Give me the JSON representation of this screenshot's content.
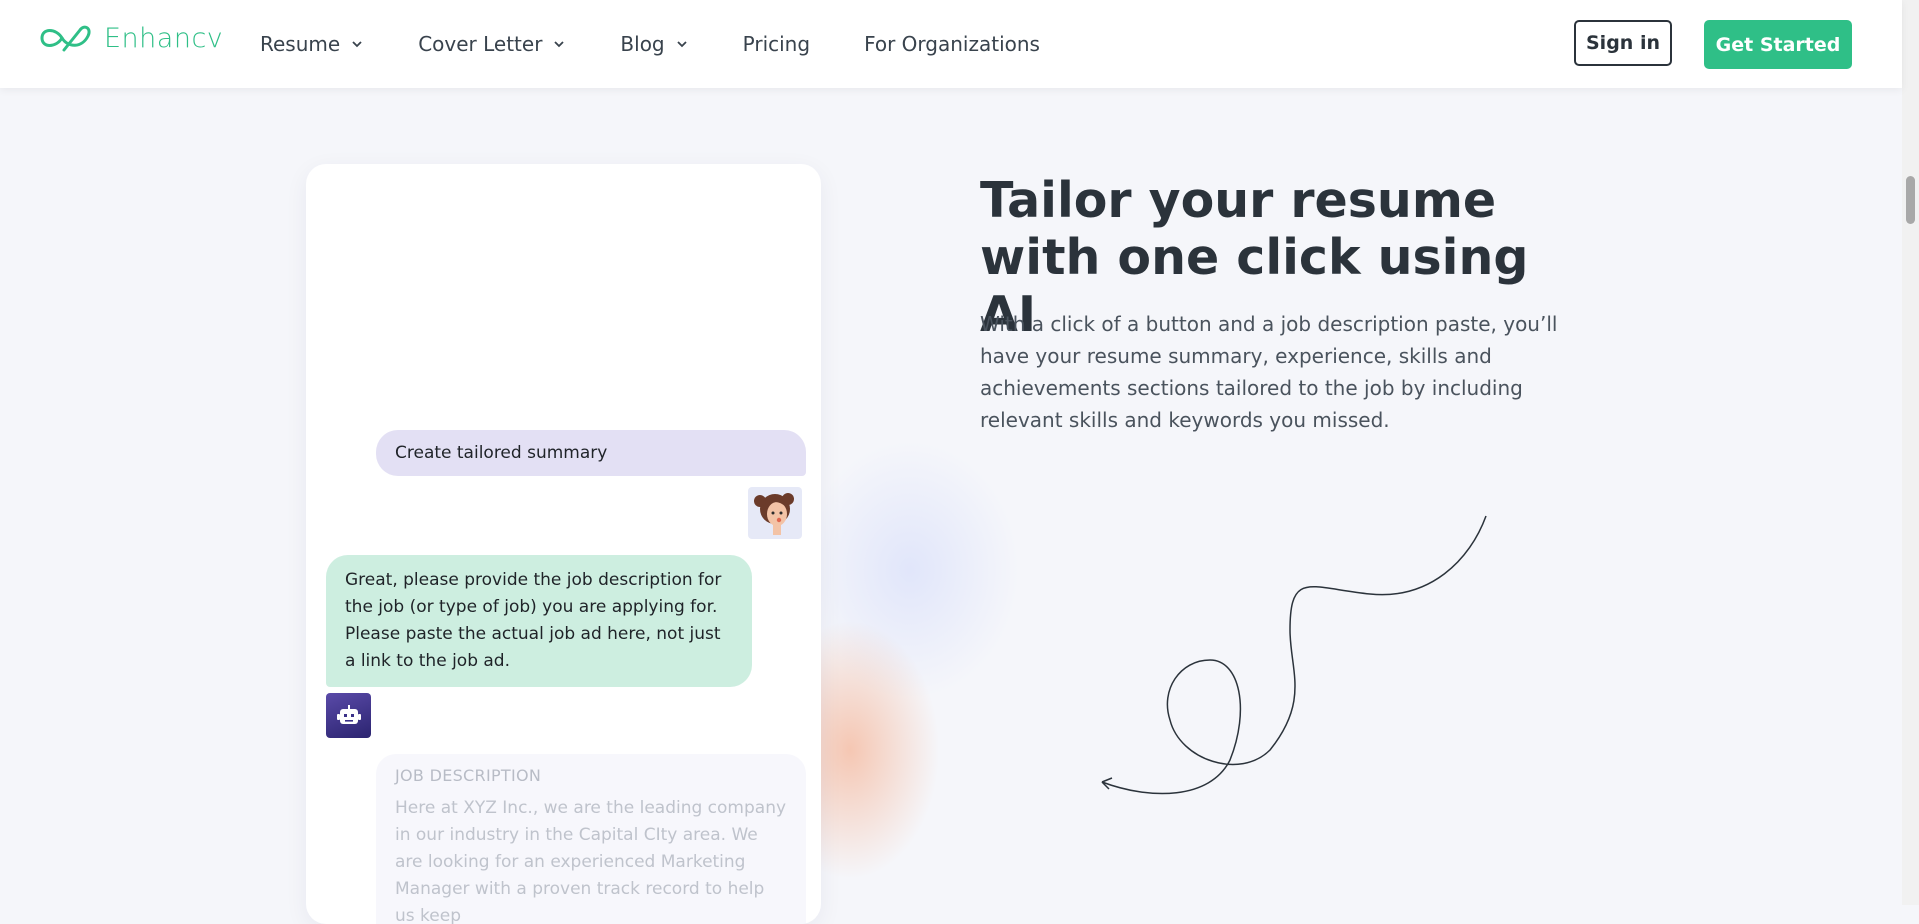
{
  "header": {
    "logo_text": "Enhancv",
    "nav": [
      {
        "label": "Resume",
        "has_dropdown": true
      },
      {
        "label": "Cover Letter",
        "has_dropdown": true
      },
      {
        "label": "Blog",
        "has_dropdown": true
      },
      {
        "label": "Pricing",
        "has_dropdown": false
      },
      {
        "label": "For Organizations",
        "has_dropdown": false
      }
    ],
    "sign_in_label": "Sign in",
    "get_started_label": "Get Started"
  },
  "chat": {
    "user_message": "Create tailored summary",
    "bot_message": "Great, please provide the job description for the job (or type of job) you are applying for. Please paste the actual job ad here, not just a link to the job ad.",
    "job_description_label": "JOB DESCRIPTION",
    "job_description_text": "Here at XYZ Inc., we are the leading company in our industry in the Capital CIty area. We are looking for an experienced Marketing Manager with a proven track record to help us keep"
  },
  "hero": {
    "headline": "Tailor your resume with one click using AI",
    "description": "With a click of a button and a job description paste, you’ll have your resume summary, experience, skills and achievements sections tailored to the job by including relevant skills and keywords you missed."
  },
  "colors": {
    "brand": "#2fbf87",
    "user_bubble": "#e3e0f4",
    "bot_bubble": "#cdeee0",
    "background": "#f5f6fa"
  }
}
